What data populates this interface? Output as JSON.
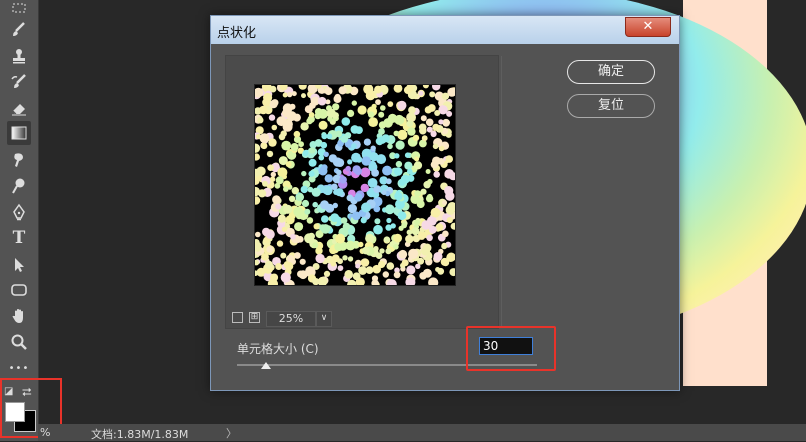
{
  "dialog": {
    "title": "点状化",
    "close_label": "✕",
    "ok_label": "确定",
    "reset_label": "复位",
    "zoom_value": "25%",
    "cell_size_label": "单元格大小 (C)",
    "cell_size_value": "30",
    "slider_value": 30
  },
  "status": {
    "zoom": "%",
    "doc_info": "文档:1.83M/1.83M",
    "arrow": "〉"
  },
  "colors": {
    "foreground": "#ffffff",
    "background": "#000000",
    "highlight": "#e8332a"
  },
  "tools": [
    "marquee-icon",
    "brush-icon",
    "stamp-icon",
    "history-brush-icon",
    "eraser-icon",
    "gradient-icon",
    "smudge-icon",
    "dodge-icon",
    "pen-icon",
    "type-icon",
    "path-select-icon",
    "shape-icon",
    "hand-icon",
    "zoom-icon",
    "more-icon"
  ],
  "tool_text": {
    "type": "T",
    "more": "•••"
  },
  "swatch_text": {
    "mini": "◪",
    "swap": "⮂"
  }
}
